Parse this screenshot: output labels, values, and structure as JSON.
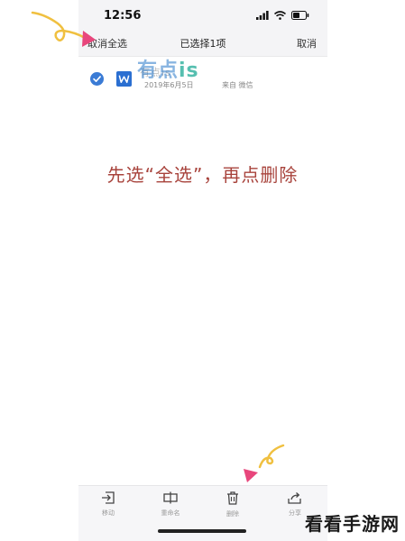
{
  "status_bar": {
    "time": "12:56"
  },
  "nav": {
    "left_label": "取消全选",
    "title": "已选择1项",
    "right_label": "取消"
  },
  "file": {
    "name": "有点is",
    "date": "2019年6月5日",
    "source": "来自 微信"
  },
  "toolbar": {
    "items": [
      {
        "label": "移动",
        "icon": "move-icon"
      },
      {
        "label": "重命名",
        "icon": "rename-icon"
      },
      {
        "label": "删除",
        "icon": "trash-icon"
      },
      {
        "label": "分享",
        "icon": "share-icon"
      }
    ]
  },
  "instruction": "先选“全选”，再点删除",
  "watermark": {
    "part1": "有点",
    "part2": "is"
  },
  "corner_watermark": "看看手游网",
  "colors": {
    "accent_blue": "#3a7bd5",
    "word_blue": "#2b6fd1",
    "instruction_red": "#a8433c",
    "arrow_pink": "#e8467c",
    "arrow_yellow": "#f0c040"
  }
}
